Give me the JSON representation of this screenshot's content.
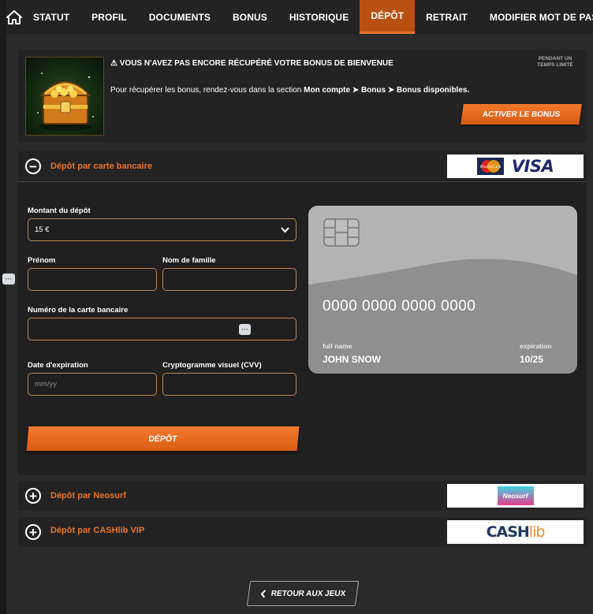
{
  "nav": {
    "tabs": [
      "STATUT",
      "PROFIL",
      "DOCUMENTS",
      "BONUS",
      "HISTORIQUE",
      "DÉPÔT",
      "RETRAIT",
      "MODIFIER MOT DE PASSE"
    ],
    "active": "DÉPÔT"
  },
  "banner": {
    "title": "VOUS N'AVEZ PAS ENCORE RÉCUPÉRÉ VOTRE BONUS DE BIENVENUE",
    "desc_prefix": "Pour récupérer les bonus, rendez-vous dans la section ",
    "desc_path": "Mon compte ➤ Bonus ➤ Bonus disponibles.",
    "limited": "PENDANT UN TEMPS LIMITÉ",
    "activate_label": "ACTIVER LE BONUS"
  },
  "sections": {
    "card": {
      "label": "Dépôt par carte bancaire",
      "sign": "−",
      "logo_text": "VISA",
      "logo_mc": "MasterCard"
    },
    "neosurf": {
      "label": "Dépôt par Neosurf",
      "sign": "+",
      "logo_text": "Neosurf"
    },
    "cashlib": {
      "label": "Dépôt par CASHlib VIP",
      "sign": "+",
      "logo_text_a": "CASH",
      "logo_text_b": "lib"
    }
  },
  "form": {
    "amount_label": "Montant du dépôt",
    "amount_value": "15 €",
    "firstname_label": "Prénom",
    "lastname_label": "Nom de famille",
    "cardnum_label": "Numéro de la carte bancaire",
    "expiry_label": "Date d'expiration",
    "expiry_placeholder": "mm/yy",
    "cvv_label": "Cryptogramme visuel (CVV)",
    "submit_label": "DÉPÔT",
    "dots": "···"
  },
  "card_preview": {
    "number": "0000 0000 0000 0000",
    "name_caption": "full name",
    "name": "JOHN SNOW",
    "exp_caption": "expiration",
    "exp": "10/25"
  },
  "footer": {
    "back_label": "RETOUR AUX JEUX",
    "back_icon": "chevron-left-icon"
  },
  "colors": {
    "accent": "#e8732a",
    "active_tab": "#b85011",
    "field_border": "#b88a55"
  }
}
